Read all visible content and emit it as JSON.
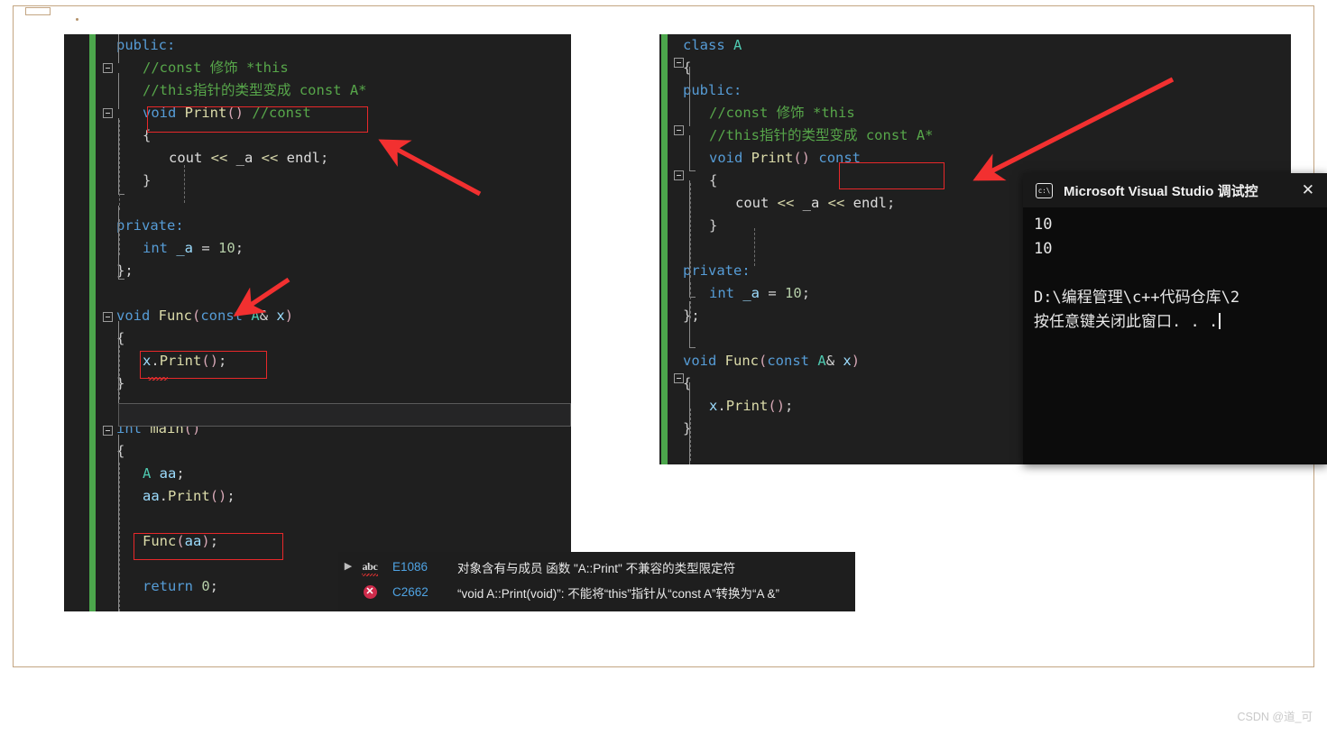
{
  "watermark": "CSDN @道_可",
  "left_editor": {
    "name": "visual-studio-code-editor-left",
    "lines": [
      {
        "indent": 0,
        "segments": [
          {
            "t": "public:",
            "c": "kw"
          }
        ]
      },
      {
        "indent": 1,
        "segments": [
          {
            "t": "//const 修饰 *this",
            "c": "cmt"
          }
        ]
      },
      {
        "indent": 1,
        "segments": [
          {
            "t": "//this指针的类型变成 const A*",
            "c": "cmt"
          }
        ]
      },
      {
        "indent": 1,
        "segments": [
          {
            "t": "void ",
            "c": "kw"
          },
          {
            "t": "Print",
            "c": "fn"
          },
          {
            "t": "()",
            "c": "par"
          },
          {
            "t": " ",
            "c": "txt"
          },
          {
            "t": "//const",
            "c": "cmt"
          }
        ]
      },
      {
        "indent": 1,
        "segments": [
          {
            "t": "{",
            "c": "pun"
          }
        ]
      },
      {
        "indent": 2,
        "segments": [
          {
            "t": "cout ",
            "c": "txt"
          },
          {
            "t": "<<",
            "c": "op"
          },
          {
            "t": " _a ",
            "c": "txt"
          },
          {
            "t": "<<",
            "c": "op"
          },
          {
            "t": " endl",
            "c": "txt"
          },
          {
            "t": ";",
            "c": "pun"
          }
        ]
      },
      {
        "indent": 1,
        "segments": [
          {
            "t": "}",
            "c": "pun"
          }
        ]
      },
      {
        "indent": 0,
        "segments": []
      },
      {
        "indent": 0,
        "segments": [
          {
            "t": "private:",
            "c": "kw"
          }
        ]
      },
      {
        "indent": 1,
        "segments": [
          {
            "t": "int",
            "c": "kw"
          },
          {
            "t": " _a ",
            "c": "var"
          },
          {
            "t": "=",
            "c": "pun"
          },
          {
            "t": " ",
            "c": "txt"
          },
          {
            "t": "10",
            "c": "num"
          },
          {
            "t": ";",
            "c": "pun"
          }
        ]
      },
      {
        "indent": 0,
        "segments": [
          {
            "t": "};",
            "c": "pun"
          }
        ]
      },
      {
        "indent": 0,
        "segments": []
      },
      {
        "indent": 0,
        "segments": [
          {
            "t": "void ",
            "c": "kw"
          },
          {
            "t": "Func",
            "c": "fn"
          },
          {
            "t": "(",
            "c": "par"
          },
          {
            "t": "const ",
            "c": "kw"
          },
          {
            "t": "A",
            "c": "typ"
          },
          {
            "t": "& ",
            "c": "pun"
          },
          {
            "t": "x",
            "c": "var"
          },
          {
            "t": ")",
            "c": "par"
          }
        ]
      },
      {
        "indent": 0,
        "segments": [
          {
            "t": "{",
            "c": "pun"
          }
        ]
      },
      {
        "indent": 1,
        "segments": [
          {
            "t": "x",
            "c": "var"
          },
          {
            "t": ".",
            "c": "pun"
          },
          {
            "t": "Print",
            "c": "fn"
          },
          {
            "t": "()",
            "c": "par"
          },
          {
            "t": ";",
            "c": "pun"
          }
        ]
      },
      {
        "indent": 0,
        "segments": [
          {
            "t": "}",
            "c": "pun"
          }
        ]
      },
      {
        "indent": 0,
        "segments": []
      },
      {
        "indent": 0,
        "segments": [
          {
            "t": "int ",
            "c": "kw"
          },
          {
            "t": "main",
            "c": "fn"
          },
          {
            "t": "()",
            "c": "par"
          }
        ]
      },
      {
        "indent": 0,
        "segments": [
          {
            "t": "{",
            "c": "pun"
          }
        ]
      },
      {
        "indent": 1,
        "segments": [
          {
            "t": "A",
            "c": "typ"
          },
          {
            "t": " aa",
            "c": "var"
          },
          {
            "t": ";",
            "c": "pun"
          }
        ]
      },
      {
        "indent": 1,
        "segments": [
          {
            "t": "aa",
            "c": "var"
          },
          {
            "t": ".",
            "c": "pun"
          },
          {
            "t": "Print",
            "c": "fn"
          },
          {
            "t": "()",
            "c": "par"
          },
          {
            "t": ";",
            "c": "pun"
          }
        ]
      },
      {
        "indent": 0,
        "segments": []
      },
      {
        "indent": 1,
        "segments": [
          {
            "t": "Func",
            "c": "fn"
          },
          {
            "t": "(",
            "c": "par"
          },
          {
            "t": "aa",
            "c": "var"
          },
          {
            "t": ")",
            "c": "par"
          },
          {
            "t": ";",
            "c": "pun"
          }
        ]
      },
      {
        "indent": 0,
        "segments": []
      },
      {
        "indent": 1,
        "segments": [
          {
            "t": "return ",
            "c": "kw"
          },
          {
            "t": "0",
            "c": "num"
          },
          {
            "t": ";",
            "c": "pun"
          }
        ]
      }
    ]
  },
  "right_editor": {
    "name": "visual-studio-code-editor-right",
    "lines": [
      {
        "indent": 0,
        "segments": [
          {
            "t": "class ",
            "c": "kw"
          },
          {
            "t": "A",
            "c": "typ"
          }
        ]
      },
      {
        "indent": 0,
        "segments": [
          {
            "t": "{",
            "c": "pun"
          }
        ]
      },
      {
        "indent": 0,
        "segments": [
          {
            "t": "public:",
            "c": "kw"
          }
        ]
      },
      {
        "indent": 1,
        "segments": [
          {
            "t": "//const 修饰 *this",
            "c": "cmt"
          }
        ]
      },
      {
        "indent": 1,
        "segments": [
          {
            "t": "//this指针的类型变成 const A*",
            "c": "cmt"
          }
        ]
      },
      {
        "indent": 1,
        "segments": [
          {
            "t": "void ",
            "c": "kw"
          },
          {
            "t": "Print",
            "c": "fn"
          },
          {
            "t": "()",
            "c": "par"
          },
          {
            "t": " ",
            "c": "txt"
          },
          {
            "t": "const",
            "c": "kw"
          }
        ]
      },
      {
        "indent": 1,
        "segments": [
          {
            "t": "{",
            "c": "pun"
          }
        ]
      },
      {
        "indent": 2,
        "segments": [
          {
            "t": "cout ",
            "c": "txt"
          },
          {
            "t": "<<",
            "c": "op"
          },
          {
            "t": " _a ",
            "c": "txt"
          },
          {
            "t": "<<",
            "c": "op"
          },
          {
            "t": " endl",
            "c": "txt"
          },
          {
            "t": ";",
            "c": "pun"
          }
        ]
      },
      {
        "indent": 1,
        "segments": [
          {
            "t": "}",
            "c": "pun"
          }
        ]
      },
      {
        "indent": 0,
        "segments": []
      },
      {
        "indent": 0,
        "segments": [
          {
            "t": "private:",
            "c": "kw"
          }
        ]
      },
      {
        "indent": 1,
        "segments": [
          {
            "t": "int",
            "c": "kw"
          },
          {
            "t": " _a ",
            "c": "var"
          },
          {
            "t": "=",
            "c": "pun"
          },
          {
            "t": " ",
            "c": "txt"
          },
          {
            "t": "10",
            "c": "num"
          },
          {
            "t": ";",
            "c": "pun"
          }
        ]
      },
      {
        "indent": 0,
        "segments": [
          {
            "t": "};",
            "c": "pun"
          }
        ]
      },
      {
        "indent": 0,
        "segments": []
      },
      {
        "indent": 0,
        "segments": [
          {
            "t": "void ",
            "c": "kw"
          },
          {
            "t": "Func",
            "c": "fn"
          },
          {
            "t": "(",
            "c": "par"
          },
          {
            "t": "const ",
            "c": "kw"
          },
          {
            "t": "A",
            "c": "typ"
          },
          {
            "t": "& ",
            "c": "pun"
          },
          {
            "t": "x",
            "c": "var"
          },
          {
            "t": ")",
            "c": "par"
          }
        ]
      },
      {
        "indent": 0,
        "segments": [
          {
            "t": "{",
            "c": "pun"
          }
        ]
      },
      {
        "indent": 1,
        "segments": [
          {
            "t": "x",
            "c": "var"
          },
          {
            "t": ".",
            "c": "pun"
          },
          {
            "t": "Print",
            "c": "fn"
          },
          {
            "t": "()",
            "c": "par"
          },
          {
            "t": ";",
            "c": "pun"
          }
        ]
      },
      {
        "indent": 0,
        "segments": [
          {
            "t": "}",
            "c": "pun"
          }
        ]
      }
    ]
  },
  "error_list": {
    "rows": [
      {
        "expander": "▶",
        "icon": "intellisense-squiggle-icon",
        "icon_text": "abc",
        "code": "E1086",
        "message": "对象含有与成员 函数 \"A::Print\" 不兼容的类型限定符"
      },
      {
        "expander": "",
        "icon": "error-x-icon",
        "icon_text": "✕",
        "code": "C2662",
        "message": "“void A::Print(void)”: 不能将“this”指针从“const A”转换为“A &”"
      }
    ]
  },
  "console": {
    "icon": "console-window-icon",
    "icon_text": "c:\\",
    "title": "Microsoft Visual Studio 调试控",
    "close_label": "✕",
    "output_lines": [
      "10",
      "10",
      "",
      "D:\\编程管理\\c++代码仓库\\2",
      "按任意键关闭此窗口. . ."
    ]
  },
  "annotations": {
    "boxes": [
      {
        "name": "highlight-box-print-commented-const"
      },
      {
        "name": "highlight-box-x-print-call"
      },
      {
        "name": "highlight-box-func-aa-call"
      },
      {
        "name": "highlight-box-print-const"
      }
    ],
    "arrows": [
      {
        "name": "arrow-to-print-commented-const"
      },
      {
        "name": "arrow-to-func-definition"
      },
      {
        "name": "arrow-to-print-const"
      }
    ]
  },
  "colors": {
    "editor_background": "#1f1f1f",
    "change_marker_green": "#4ca64c",
    "annotation_red": "#e8282a",
    "keyword_blue": "#569cd6",
    "function_yellow": "#dcdcaa",
    "type_teal": "#4ec9b0",
    "comment_green": "#57a64a",
    "error_code_blue": "#4fa3e3",
    "console_background": "#0c0c0c",
    "frame_border": "#c3a582"
  }
}
